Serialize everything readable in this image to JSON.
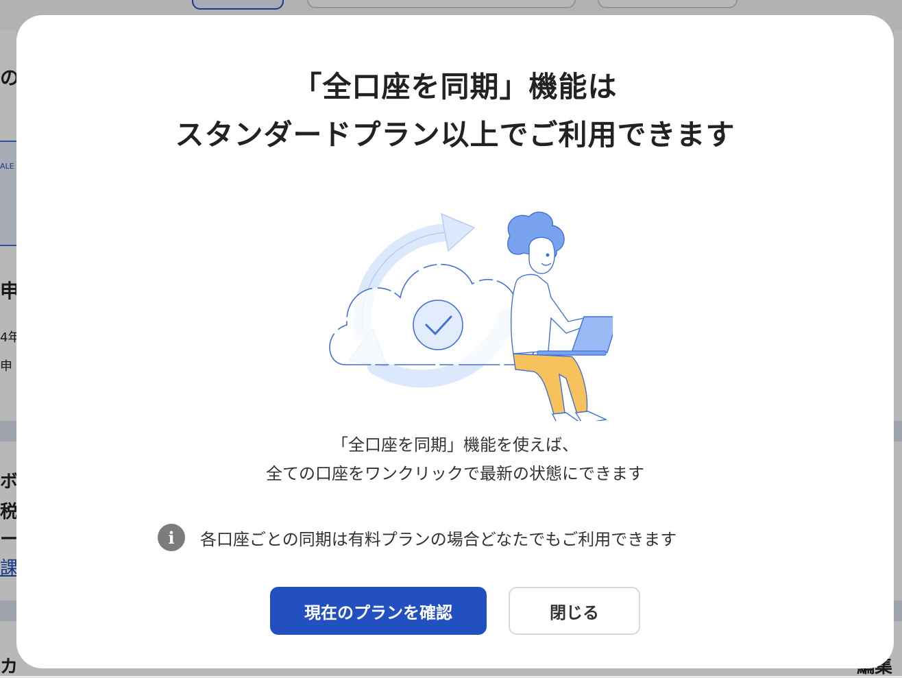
{
  "background": {
    "fragments": [
      "の",
      "ALE",
      "申",
      "4年",
      "申",
      "ボ",
      "税",
      "ー",
      "課",
      "カ",
      "編集"
    ]
  },
  "modal": {
    "title_line1": "「全口座を同期」機能は",
    "title_line2": "スタンダードプラン以上でご利用できます",
    "description_line1": "「全口座を同期」機能を使えば、",
    "description_line2": "全ての口座をワンクリックで最新の状態にできます",
    "info_glyph": "i",
    "note": "各口座ごとの同期は有料プランの場合どなたでもご利用できます",
    "primary_button": "現在のプランを確認",
    "secondary_button": "閉じる",
    "illustration": "cloud-sync-person-laptop",
    "colors": {
      "primary": "#2350c0",
      "illustration_blue": "#3f6fd8",
      "illustration_light_blue": "#dce8fb",
      "hair": "#7aa3ef",
      "pants": "#f7c15c"
    }
  }
}
